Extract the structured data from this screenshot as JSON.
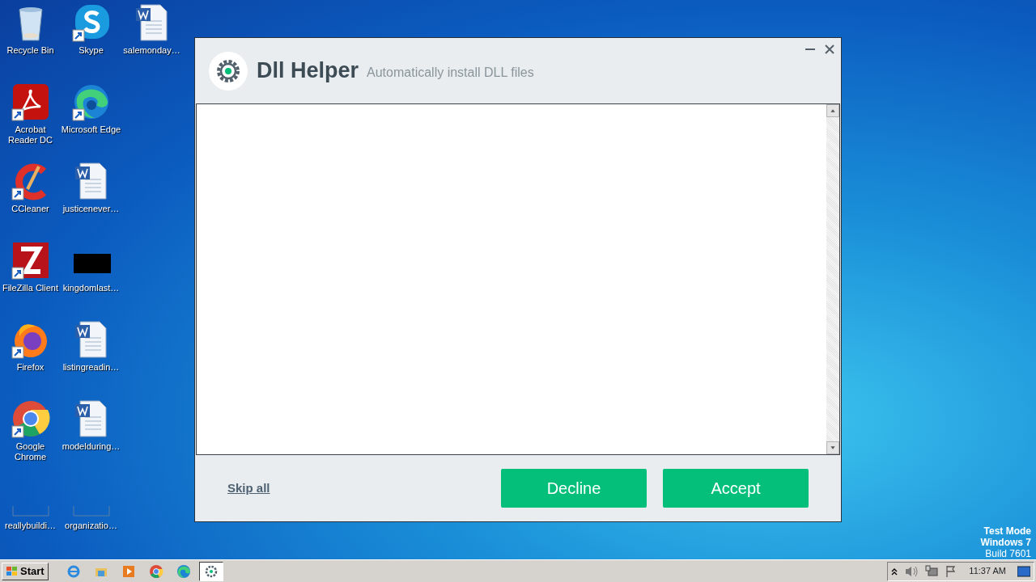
{
  "desktop_icons": [
    {
      "label": "Recycle Bin",
      "kind": "recycle",
      "shortcut": false
    },
    {
      "label": "Acrobat Reader DC",
      "kind": "acrobat",
      "shortcut": true
    },
    {
      "label": "CCleaner",
      "kind": "ccleaner",
      "shortcut": true
    },
    {
      "label": "FileZilla Client",
      "kind": "filezilla",
      "shortcut": true
    },
    {
      "label": "Firefox",
      "kind": "firefox",
      "shortcut": true
    },
    {
      "label": "Google Chrome",
      "kind": "chrome",
      "shortcut": true
    },
    {
      "label": "reallybuildi…",
      "kind": "blank",
      "shortcut": false
    },
    {
      "label": "Skype",
      "kind": "skype",
      "shortcut": true
    },
    {
      "label": "Microsoft Edge",
      "kind": "edge",
      "shortcut": true
    },
    {
      "label": "justicenever…",
      "kind": "word",
      "shortcut": false
    },
    {
      "label": "kingdomlast…",
      "kind": "black",
      "shortcut": false
    },
    {
      "label": "listingreadin…",
      "kind": "word",
      "shortcut": false
    },
    {
      "label": "modelduring…",
      "kind": "word",
      "shortcut": false
    },
    {
      "label": "organizatio…",
      "kind": "blank",
      "shortcut": false
    },
    {
      "label": "salemonday…",
      "kind": "word",
      "shortcut": false
    }
  ],
  "window": {
    "title": "Dll Helper",
    "subtitle": "Automatically install DLL files",
    "skip_link": "Skip all",
    "buttons": [
      {
        "label": "Decline"
      },
      {
        "label": "Accept"
      }
    ]
  },
  "os_watermark": [
    "Test Mode",
    "Windows 7",
    "Build 7601"
  ],
  "taskbar": {
    "start": "Start",
    "apps": [
      {
        "kind": "ie",
        "selected": false
      },
      {
        "kind": "explorer",
        "selected": false
      },
      {
        "kind": "media",
        "selected": false
      },
      {
        "kind": "chrome",
        "selected": false
      },
      {
        "kind": "edge",
        "selected": false
      },
      {
        "kind": "gear",
        "selected": true
      }
    ],
    "clock": "11:37 AM"
  }
}
